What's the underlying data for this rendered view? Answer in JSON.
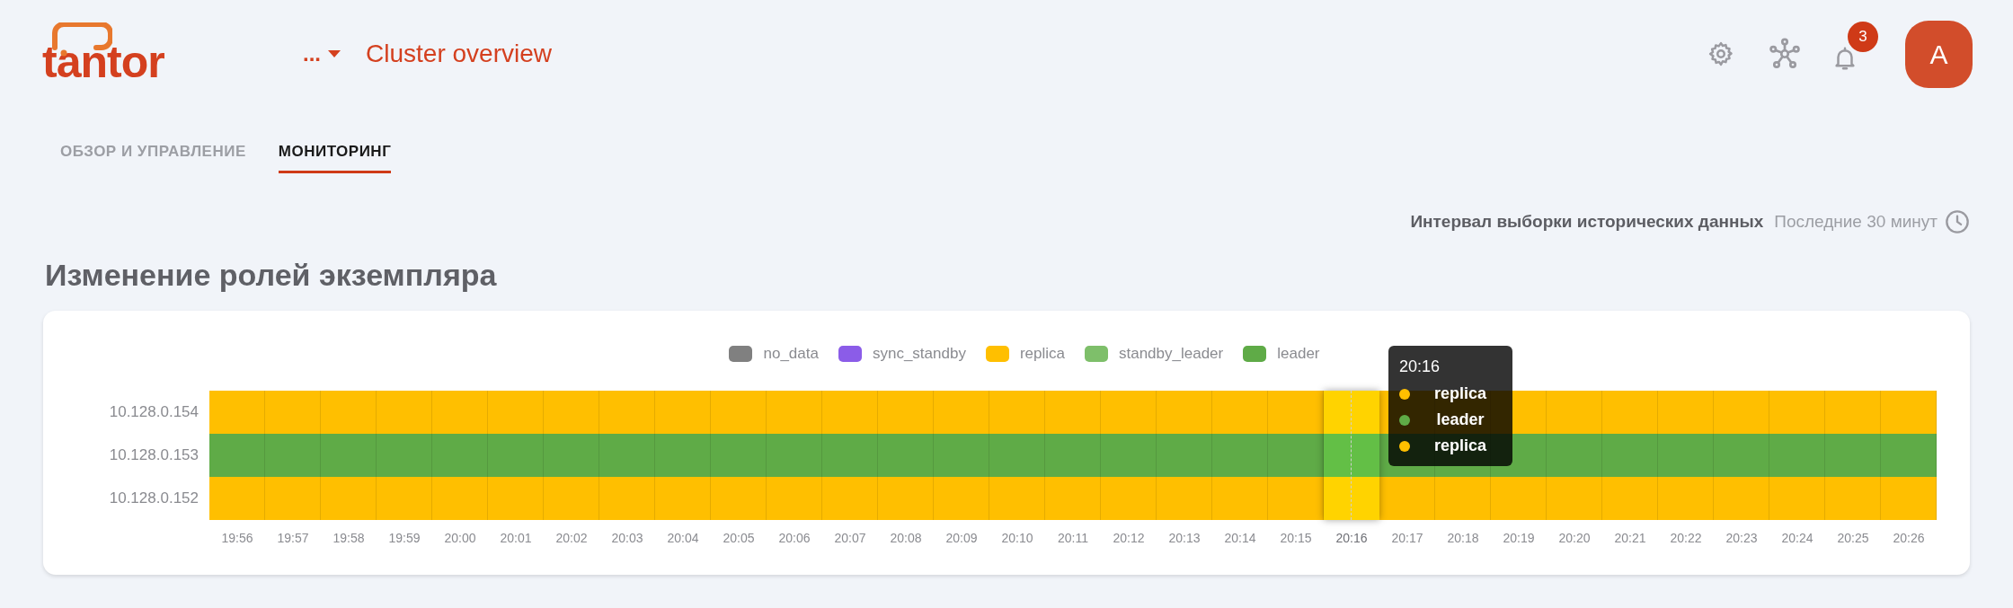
{
  "header": {
    "logo": "tantor",
    "cluster_menu": "...",
    "page_title": "Cluster overview",
    "notifications_count": "3",
    "avatar": "A"
  },
  "tabs": [
    {
      "label": "ОБЗОР И УПРАВЛЕНИЕ",
      "selected": false
    },
    {
      "label": "МОНИТОРИНГ",
      "selected": true
    }
  ],
  "interval": {
    "label": "Интервал выборки исторических данных",
    "value": "Последние 30 минут"
  },
  "section_title": "Изменение ролей экземпляра",
  "chart": {
    "legend": [
      {
        "label": "no_data",
        "color": "#808080"
      },
      {
        "label": "sync_standby",
        "color": "#8b5ce8"
      },
      {
        "label": "replica",
        "color": "#ffbf00"
      },
      {
        "label": "standby_leader",
        "color": "#7ebf6a"
      },
      {
        "label": "leader",
        "color": "#5fab47"
      }
    ],
    "rows": [
      {
        "label": "10.128.0.154",
        "color": "#ffbf00"
      },
      {
        "label": "10.128.0.153",
        "color": "#5fab47"
      },
      {
        "label": "10.128.0.152",
        "color": "#ffbf00"
      }
    ],
    "xticks": [
      {
        "label": "19:56",
        "selected": false
      },
      {
        "label": "19:57",
        "selected": false
      },
      {
        "label": "19:58",
        "selected": false
      },
      {
        "label": "19:59",
        "selected": false
      },
      {
        "label": "20:00",
        "selected": false
      },
      {
        "label": "20:01",
        "selected": false
      },
      {
        "label": "20:02",
        "selected": false
      },
      {
        "label": "20:03",
        "selected": false
      },
      {
        "label": "20:04",
        "selected": false
      },
      {
        "label": "20:05",
        "selected": false
      },
      {
        "label": "20:06",
        "selected": false
      },
      {
        "label": "20:07",
        "selected": false
      },
      {
        "label": "20:08",
        "selected": false
      },
      {
        "label": "20:09",
        "selected": false
      },
      {
        "label": "20:10",
        "selected": false
      },
      {
        "label": "20:11",
        "selected": false
      },
      {
        "label": "20:12",
        "selected": false
      },
      {
        "label": "20:13",
        "selected": false
      },
      {
        "label": "20:14",
        "selected": false
      },
      {
        "label": "20:15",
        "selected": false
      },
      {
        "label": "20:16",
        "selected": true
      },
      {
        "label": "20:17",
        "selected": false
      },
      {
        "label": "20:18",
        "selected": false
      },
      {
        "label": "20:19",
        "selected": false
      },
      {
        "label": "20:20",
        "selected": false
      },
      {
        "label": "20:21",
        "selected": false
      },
      {
        "label": "20:22",
        "selected": false
      },
      {
        "label": "20:23",
        "selected": false
      },
      {
        "label": "20:24",
        "selected": false
      },
      {
        "label": "20:25",
        "selected": false
      },
      {
        "label": "20:26",
        "selected": false
      }
    ],
    "tooltip": {
      "time": "20:16",
      "entries": [
        {
          "label": "replica",
          "color": "#ffbf00"
        },
        {
          "label": "leader",
          "color": "#5fab47"
        },
        {
          "label": "replica",
          "color": "#ffbf00"
        }
      ]
    }
  }
}
